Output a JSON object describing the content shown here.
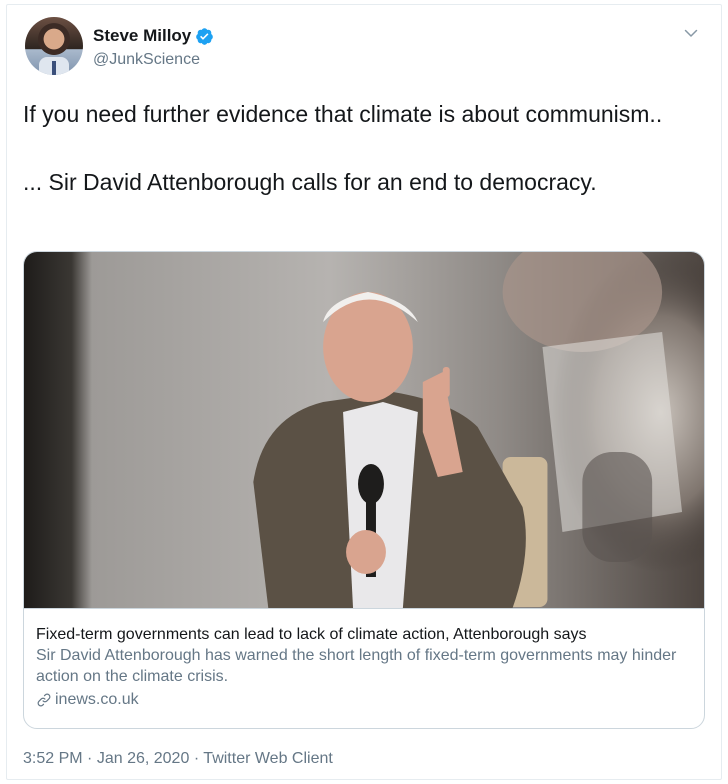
{
  "user": {
    "display_name": "Steve Milloy",
    "handle": "@JunkScience",
    "avatar_icon": "user-avatar",
    "verified_icon": "verified-badge-icon"
  },
  "tweet": {
    "line1": "If you need further evidence that climate is about communism..",
    "line2": "... Sir David Attenborough calls for an end to democracy."
  },
  "card": {
    "title": "Fixed-term governments can lead to lack of climate action, Attenborough says",
    "description": "Sir David Attenborough has warned the short length of fixed-term governments may hinder action on the climate crisis.",
    "domain": "inews.co.uk",
    "link_icon": "link-icon"
  },
  "meta": {
    "time": "3:52 PM",
    "separator": "·",
    "date": "Jan 26, 2020",
    "source": "Twitter Web Client"
  },
  "colors": {
    "text": "#14171a",
    "secondary": "#657786",
    "verified": "#1da1f2",
    "border": "#ccd6dd"
  }
}
